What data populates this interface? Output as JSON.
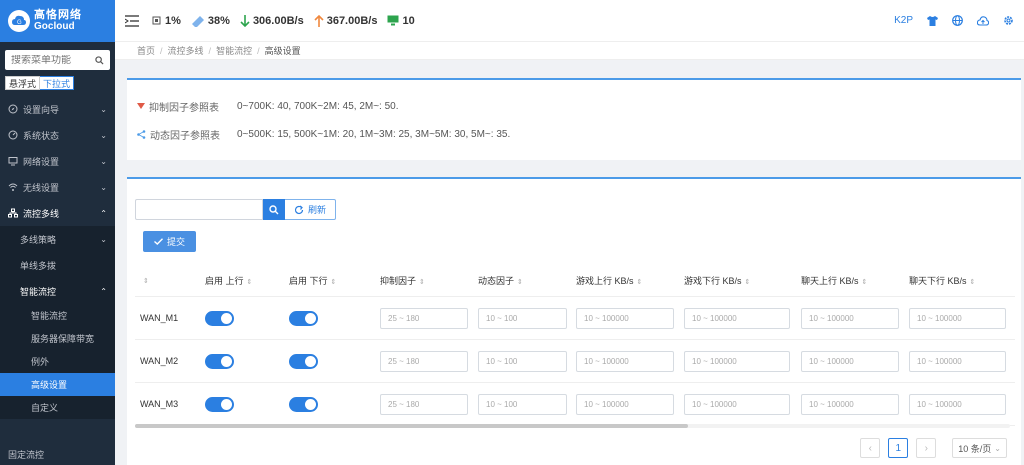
{
  "brand": {
    "name_cn": "高恪网络",
    "name_en": "Gocloud"
  },
  "sidebar": {
    "search_placeholder": "搜索菜单功能",
    "mode_float": "悬浮式",
    "mode_dropdown": "下拉式",
    "items": [
      {
        "label": "设置向导",
        "icon": "compass-icon"
      },
      {
        "label": "系统状态",
        "icon": "gauge-icon"
      },
      {
        "label": "网络设置",
        "icon": "monitor-icon"
      },
      {
        "label": "无线设置",
        "icon": "wifi-icon"
      },
      {
        "label": "流控多线",
        "icon": "network-icon"
      }
    ],
    "sub_items": [
      "多线策略",
      "单线多拨",
      "智能流控"
    ],
    "sub2_items": [
      "智能流控",
      "服务器保障带宽",
      "例外",
      "高级设置",
      "自定义"
    ],
    "bottom_item": "固定流控"
  },
  "header": {
    "cpu": "1%",
    "memory": "38%",
    "download": "306.00B/s",
    "upload": "367.00B/s",
    "devices": "10",
    "k2p": "K2P"
  },
  "breadcrumb": [
    "首页",
    "流控多线",
    "智能流控",
    "高级设置"
  ],
  "references": [
    {
      "label": "抑制因子参照表",
      "value": "0~700K: 40, 700K~2M: 45, 2M~: 50."
    },
    {
      "label": "动态因子参照表",
      "value": "0~500K: 15, 500K~1M: 20, 1M~3M: 25, 3M~5M: 30, 5M~: 35."
    }
  ],
  "toolbar": {
    "refresh": "刷新",
    "submit": "提交"
  },
  "table": {
    "headers": [
      "",
      "启用 上行",
      "启用 下行",
      "抑制因子",
      "动态因子",
      "游戏上行 KB/s",
      "游戏下行 KB/s",
      "聊天上行 KB/s",
      "聊天下行 KB/s"
    ],
    "placeholders": [
      "25 ~ 180",
      "10 ~ 100",
      "10 ~ 100000",
      "10 ~ 100000",
      "10 ~ 100000",
      "10 ~ 100000"
    ],
    "rows": [
      {
        "name": "WAN_M1",
        "up": true,
        "down": true
      },
      {
        "name": "WAN_M2",
        "up": true,
        "down": true
      },
      {
        "name": "WAN_M3",
        "up": true,
        "down": true
      }
    ]
  },
  "pager": {
    "current": "1",
    "page_size": "10 条/页"
  },
  "colors": {
    "accent": "#2b7fe1",
    "sidebar": "#1f2d3d"
  }
}
